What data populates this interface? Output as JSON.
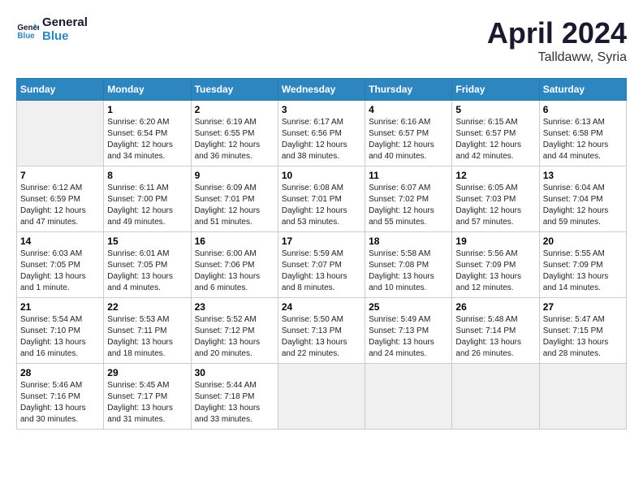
{
  "header": {
    "logo_line1": "General",
    "logo_line2": "Blue",
    "main_title": "April 2024",
    "subtitle": "Talldaww, Syria"
  },
  "days_of_week": [
    "Sunday",
    "Monday",
    "Tuesday",
    "Wednesday",
    "Thursday",
    "Friday",
    "Saturday"
  ],
  "weeks": [
    [
      {
        "day": "",
        "info": ""
      },
      {
        "day": "1",
        "info": "Sunrise: 6:20 AM\nSunset: 6:54 PM\nDaylight: 12 hours\nand 34 minutes."
      },
      {
        "day": "2",
        "info": "Sunrise: 6:19 AM\nSunset: 6:55 PM\nDaylight: 12 hours\nand 36 minutes."
      },
      {
        "day": "3",
        "info": "Sunrise: 6:17 AM\nSunset: 6:56 PM\nDaylight: 12 hours\nand 38 minutes."
      },
      {
        "day": "4",
        "info": "Sunrise: 6:16 AM\nSunset: 6:57 PM\nDaylight: 12 hours\nand 40 minutes."
      },
      {
        "day": "5",
        "info": "Sunrise: 6:15 AM\nSunset: 6:57 PM\nDaylight: 12 hours\nand 42 minutes."
      },
      {
        "day": "6",
        "info": "Sunrise: 6:13 AM\nSunset: 6:58 PM\nDaylight: 12 hours\nand 44 minutes."
      }
    ],
    [
      {
        "day": "7",
        "info": "Sunrise: 6:12 AM\nSunset: 6:59 PM\nDaylight: 12 hours\nand 47 minutes."
      },
      {
        "day": "8",
        "info": "Sunrise: 6:11 AM\nSunset: 7:00 PM\nDaylight: 12 hours\nand 49 minutes."
      },
      {
        "day": "9",
        "info": "Sunrise: 6:09 AM\nSunset: 7:01 PM\nDaylight: 12 hours\nand 51 minutes."
      },
      {
        "day": "10",
        "info": "Sunrise: 6:08 AM\nSunset: 7:01 PM\nDaylight: 12 hours\nand 53 minutes."
      },
      {
        "day": "11",
        "info": "Sunrise: 6:07 AM\nSunset: 7:02 PM\nDaylight: 12 hours\nand 55 minutes."
      },
      {
        "day": "12",
        "info": "Sunrise: 6:05 AM\nSunset: 7:03 PM\nDaylight: 12 hours\nand 57 minutes."
      },
      {
        "day": "13",
        "info": "Sunrise: 6:04 AM\nSunset: 7:04 PM\nDaylight: 12 hours\nand 59 minutes."
      }
    ],
    [
      {
        "day": "14",
        "info": "Sunrise: 6:03 AM\nSunset: 7:05 PM\nDaylight: 13 hours\nand 1 minute."
      },
      {
        "day": "15",
        "info": "Sunrise: 6:01 AM\nSunset: 7:05 PM\nDaylight: 13 hours\nand 4 minutes."
      },
      {
        "day": "16",
        "info": "Sunrise: 6:00 AM\nSunset: 7:06 PM\nDaylight: 13 hours\nand 6 minutes."
      },
      {
        "day": "17",
        "info": "Sunrise: 5:59 AM\nSunset: 7:07 PM\nDaylight: 13 hours\nand 8 minutes."
      },
      {
        "day": "18",
        "info": "Sunrise: 5:58 AM\nSunset: 7:08 PM\nDaylight: 13 hours\nand 10 minutes."
      },
      {
        "day": "19",
        "info": "Sunrise: 5:56 AM\nSunset: 7:09 PM\nDaylight: 13 hours\nand 12 minutes."
      },
      {
        "day": "20",
        "info": "Sunrise: 5:55 AM\nSunset: 7:09 PM\nDaylight: 13 hours\nand 14 minutes."
      }
    ],
    [
      {
        "day": "21",
        "info": "Sunrise: 5:54 AM\nSunset: 7:10 PM\nDaylight: 13 hours\nand 16 minutes."
      },
      {
        "day": "22",
        "info": "Sunrise: 5:53 AM\nSunset: 7:11 PM\nDaylight: 13 hours\nand 18 minutes."
      },
      {
        "day": "23",
        "info": "Sunrise: 5:52 AM\nSunset: 7:12 PM\nDaylight: 13 hours\nand 20 minutes."
      },
      {
        "day": "24",
        "info": "Sunrise: 5:50 AM\nSunset: 7:13 PM\nDaylight: 13 hours\nand 22 minutes."
      },
      {
        "day": "25",
        "info": "Sunrise: 5:49 AM\nSunset: 7:13 PM\nDaylight: 13 hours\nand 24 minutes."
      },
      {
        "day": "26",
        "info": "Sunrise: 5:48 AM\nSunset: 7:14 PM\nDaylight: 13 hours\nand 26 minutes."
      },
      {
        "day": "27",
        "info": "Sunrise: 5:47 AM\nSunset: 7:15 PM\nDaylight: 13 hours\nand 28 minutes."
      }
    ],
    [
      {
        "day": "28",
        "info": "Sunrise: 5:46 AM\nSunset: 7:16 PM\nDaylight: 13 hours\nand 30 minutes."
      },
      {
        "day": "29",
        "info": "Sunrise: 5:45 AM\nSunset: 7:17 PM\nDaylight: 13 hours\nand 31 minutes."
      },
      {
        "day": "30",
        "info": "Sunrise: 5:44 AM\nSunset: 7:18 PM\nDaylight: 13 hours\nand 33 minutes."
      },
      {
        "day": "",
        "info": ""
      },
      {
        "day": "",
        "info": ""
      },
      {
        "day": "",
        "info": ""
      },
      {
        "day": "",
        "info": ""
      }
    ]
  ]
}
